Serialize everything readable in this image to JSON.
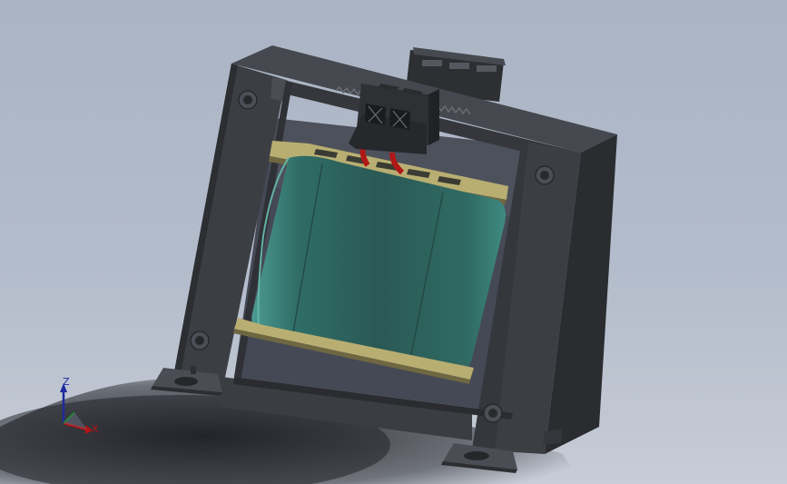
{
  "viewport": {
    "background": "#b1bac9"
  },
  "model": {
    "frame_color": "#3a3d42",
    "core_color": "#2d5b57",
    "insulator_color": "#b9ae72",
    "lead_color": "#b01818"
  },
  "triad": {
    "z_label": "Z",
    "x_label": "X",
    "z_color": "#1f2a9e",
    "x_color": "#b01414",
    "y_color": "#1c7a2a"
  }
}
